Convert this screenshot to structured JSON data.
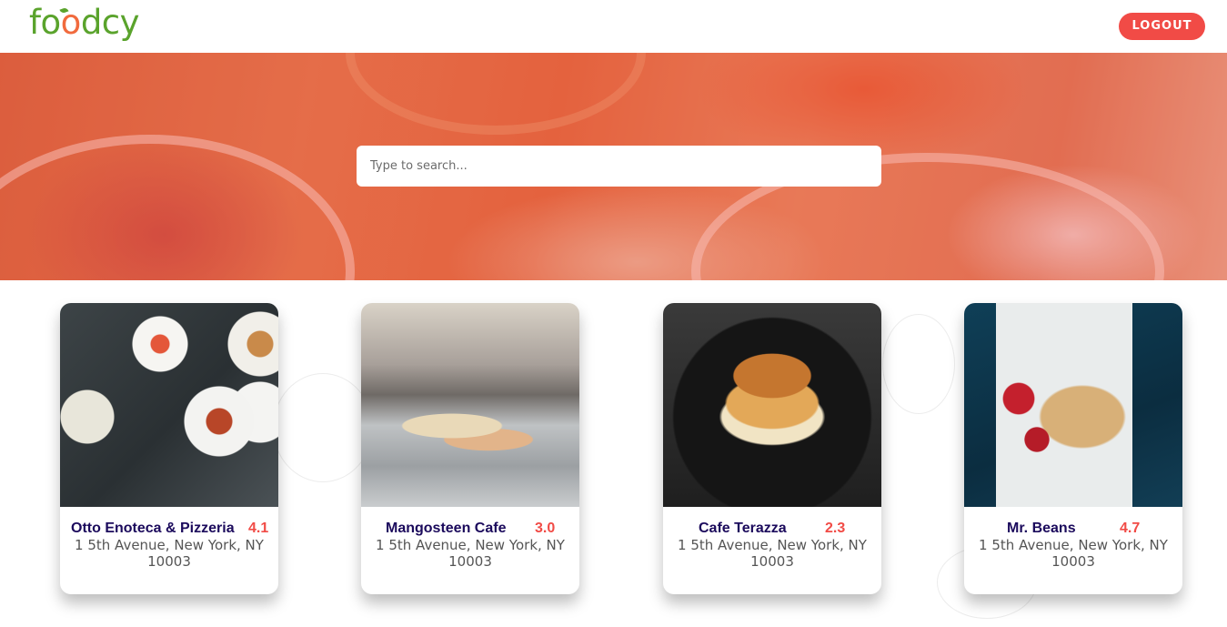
{
  "header": {
    "logo_text": "foodcy",
    "logout_label": "LOGOUT"
  },
  "search": {
    "placeholder": "Type to search..."
  },
  "restaurants": [
    {
      "name": "Otto Enoteca & Pizzeria",
      "rating": "4.1",
      "address": "1 5th Avenue, New York, NY 10003"
    },
    {
      "name": "Mangosteen Cafe",
      "rating": "3.0",
      "address": "1 5th Avenue, New York, NY 10003"
    },
    {
      "name": "Cafe Terazza",
      "rating": "2.3",
      "address": "1 5th Avenue, New York, NY 10003"
    },
    {
      "name": "Mr. Beans",
      "rating": "4.7",
      "address": "1 5th Avenue, New York, NY 10003"
    }
  ],
  "colors": {
    "brand_green": "#5aa32c",
    "brand_orange": "#f16a3d",
    "accent_red": "#f14b46",
    "title_navy": "#1b0a5c"
  }
}
